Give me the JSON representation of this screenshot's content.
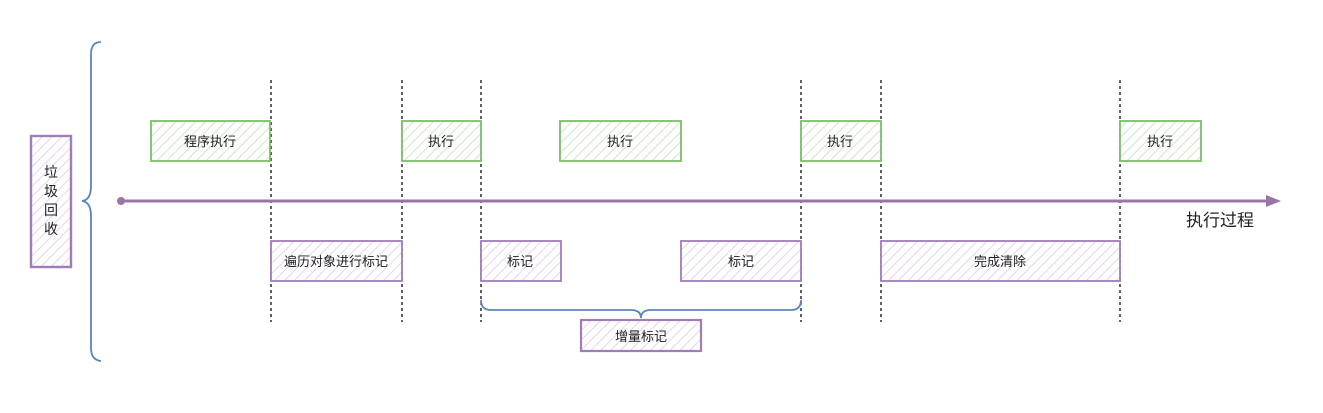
{
  "side_label": "垃圾回收",
  "axis_label": "执行过程",
  "program_boxes": [
    {
      "label": "程序执行"
    },
    {
      "label": "执行"
    },
    {
      "label": "执行"
    },
    {
      "label": "执行"
    },
    {
      "label": "执行"
    }
  ],
  "gc_boxes": [
    {
      "label": "遍历对象进行标记"
    },
    {
      "label": "标记"
    },
    {
      "label": "标记"
    },
    {
      "label": "完成清除"
    }
  ],
  "incremental_label": "增量标记",
  "colors": {
    "program_stroke": "#7cbf6a",
    "program_hatch": "#cfe8c6",
    "gc_stroke": "#a07cb8",
    "gc_hatch": "#e4d6ee",
    "axis": "#9b75a8",
    "brace": "#5b86b8",
    "guide": "#1f1f1f"
  }
}
